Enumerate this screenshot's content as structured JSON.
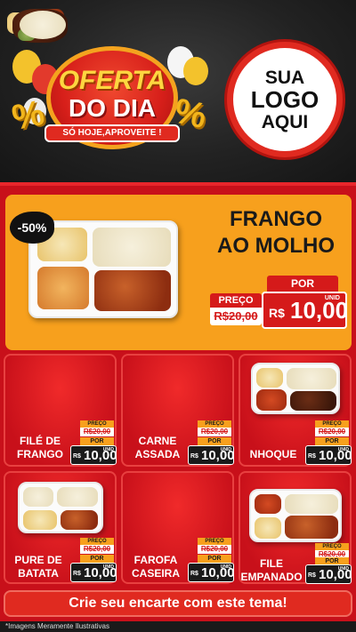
{
  "header": {
    "offer_line1": "OFERTA",
    "offer_line2": "DO DIA",
    "offer_sub": "SÓ HOJE,APROVEITE !",
    "percent_symbol": "%",
    "logo_line1": "SUA",
    "logo_line2": "LOGO",
    "logo_line3": "AQUI"
  },
  "featured": {
    "badge": "-50%",
    "name_line1": "FRANGO",
    "name_line2": "AO MOLHO",
    "preco_label": "PREÇO",
    "old_price": "R$20,00",
    "por_label": "POR",
    "currency": "R$",
    "price": "10,00",
    "unit": "UNID"
  },
  "products": [
    {
      "name_line1": "FILÉ DE",
      "name_line2": "FRANGO",
      "preco_label": "PREÇO",
      "old_price": "R$20,00",
      "por_label": "POR",
      "currency": "R$",
      "price": "10,00",
      "unit": "UNID"
    },
    {
      "name_line1": "CARNE",
      "name_line2": "ASSADA",
      "preco_label": "PREÇO",
      "old_price": "R$20,00",
      "por_label": "POR",
      "currency": "R$",
      "price": "10,00",
      "unit": "UNID"
    },
    {
      "name_line1": "NHOQUE",
      "name_line2": "",
      "preco_label": "PREÇO",
      "old_price": "R$20,00",
      "por_label": "POR",
      "currency": "R$",
      "price": "10,00",
      "unit": "UNID"
    },
    {
      "name_line1": "PURE DE",
      "name_line2": "BATATA",
      "preco_label": "PREÇO",
      "old_price": "R$20,00",
      "por_label": "POR",
      "currency": "R$",
      "price": "10,00",
      "unit": "UNID"
    },
    {
      "name_line1": "FAROFA",
      "name_line2": "CASEIRA",
      "preco_label": "PREÇO",
      "old_price": "R$20,00",
      "por_label": "POR",
      "currency": "R$",
      "price": "10,00",
      "unit": "UNID"
    },
    {
      "name_line1": "FILE",
      "name_line2": "EMPANADO",
      "preco_label": "PREÇO",
      "old_price": "R$20,00",
      "por_label": "POR",
      "currency": "R$",
      "price": "10,00",
      "unit": "UNID"
    }
  ],
  "cta": "Crie seu encarte com este tema!",
  "disclaimer": "*Imagens Meramente Ilustrativas",
  "colors": {
    "board_red": "#c8101a",
    "featured_orange": "#f7a01d",
    "accent_yellow": "#fdd640"
  }
}
